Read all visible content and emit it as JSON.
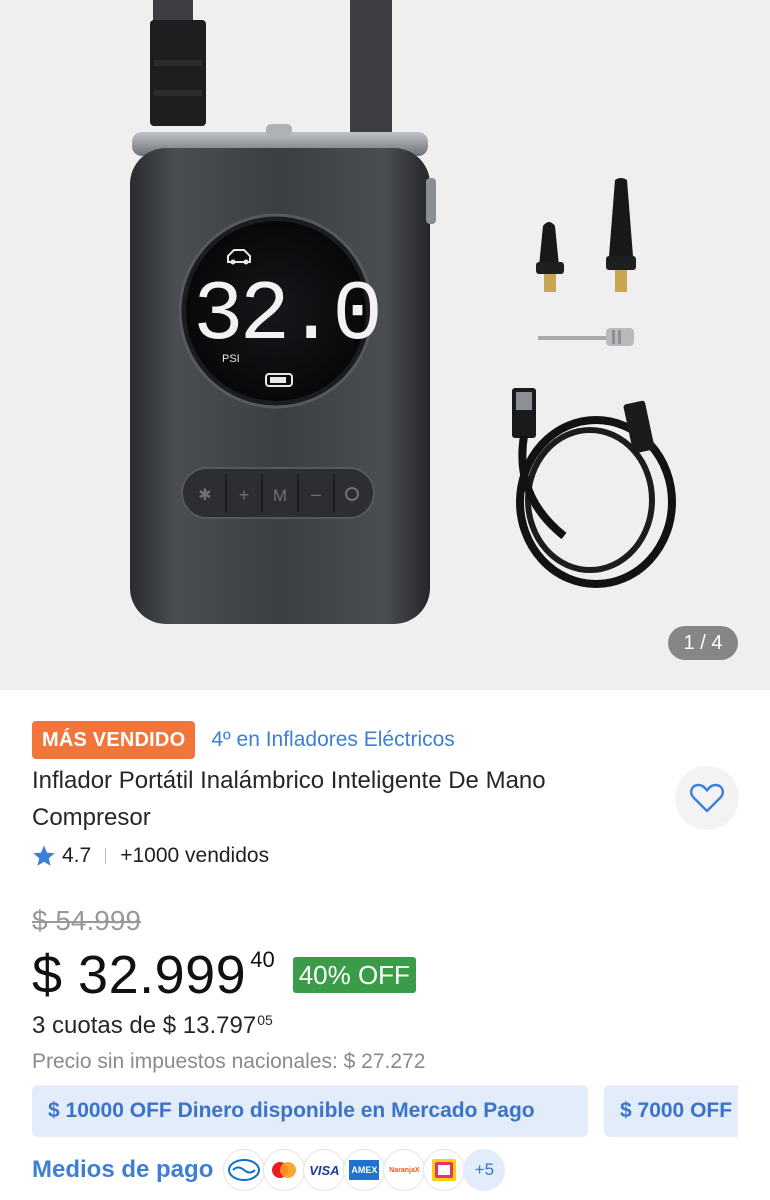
{
  "gallery": {
    "counter": "1 / 4",
    "display_value": "32.0",
    "display_unit": "PSI",
    "buttons": [
      "M"
    ]
  },
  "badges": {
    "best_seller": "MÁS VENDIDO",
    "ranking": "4º en Infladores Eléctricos"
  },
  "product": {
    "title": "Inflador Portátil Inalámbrico Inteligente De Mano Compresor",
    "rating": "4.7",
    "sold": "+1000 vendidos"
  },
  "price": {
    "original": "$ 54.999",
    "current": "$ 32.999",
    "cents": "40",
    "discount": "40% OFF",
    "installments_prefix": "3 cuotas de $ 13.797",
    "installments_cents": "05",
    "no_tax": "Precio sin impuestos nacionales: $ 27.272"
  },
  "promos": [
    "$ 10000 OFF Dinero disponible en Mercado Pago",
    "$ 7000 OFF"
  ],
  "payment": {
    "label": "Medios de pago",
    "methods": [
      "mercado-pago",
      "mastercard",
      "visa",
      "amex",
      "naranja-x",
      "pago-facil"
    ],
    "visa_text": "VISA",
    "amex_text": "AMEX",
    "naranja_text": "NaranjaX",
    "more": "+5"
  },
  "colors": {
    "badge": "#f2763c",
    "link": "#3e7fd6",
    "discount": "#3a9c48",
    "promo_bg": "#e2ecfb"
  }
}
